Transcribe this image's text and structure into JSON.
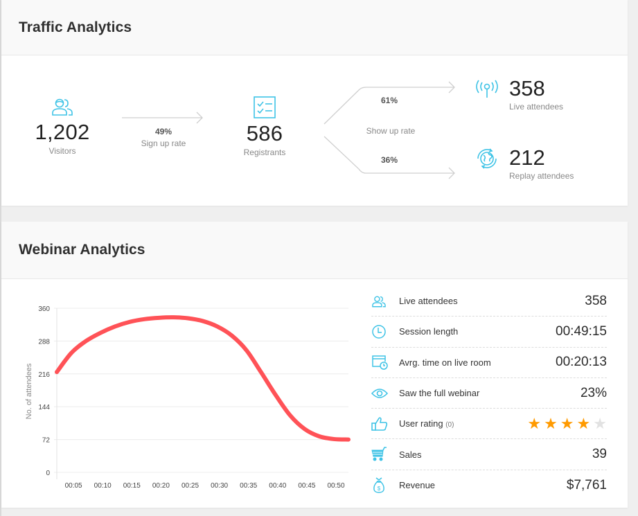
{
  "traffic": {
    "title": "Traffic Analytics",
    "visitors": {
      "value": "1,202",
      "label": "Visitors",
      "icon": "users-icon"
    },
    "signup": {
      "pct": "49%",
      "label": "Sign up rate"
    },
    "registrants": {
      "value": "586",
      "label": "Registrants",
      "icon": "checklist-icon"
    },
    "showup": {
      "label": "Show up rate",
      "live_pct": "61%",
      "replay_pct": "36%"
    },
    "live": {
      "value": "358",
      "label": "Live attendees",
      "icon": "broadcast-icon"
    },
    "replay": {
      "value": "212",
      "label": "Replay attendees",
      "icon": "globe-replay-icon"
    }
  },
  "webinar": {
    "title": "Webinar Analytics",
    "stats": [
      {
        "icon": "users-icon",
        "label": "Live attendees",
        "value": "358"
      },
      {
        "icon": "clock-icon",
        "label": "Session length",
        "value": "00:49:15"
      },
      {
        "icon": "window-clock-icon",
        "label": "Avrg. time on live room",
        "value": "00:20:13"
      },
      {
        "icon": "eye-icon",
        "label": "Saw the full webinar",
        "value": "23%"
      },
      {
        "icon": "thumbs-up-icon",
        "label": "User rating",
        "count": "(0)",
        "rating": 4,
        "rating_max": 5
      },
      {
        "icon": "cart-icon",
        "label": "Sales",
        "value": "39"
      },
      {
        "icon": "money-bag-icon",
        "label": "Revenue",
        "value": "$7,761"
      }
    ],
    "colors": {
      "accent": "#3ec3e6",
      "curve": "#ff5257",
      "star_on": "#ff9a00",
      "star_off": "#e2e2e2"
    }
  },
  "chart_data": {
    "type": "line",
    "title": "",
    "xlabel": "",
    "ylabel": "No. of attendees",
    "x_ticks": [
      "00:05",
      "00:10",
      "00:15",
      "00:20",
      "00:25",
      "00:30",
      "00:35",
      "00:40",
      "00:45",
      "00:50"
    ],
    "y_ticks": [
      0,
      72,
      144,
      216,
      288,
      360
    ],
    "ylim": [
      0,
      360
    ],
    "xlim_minutes": [
      0,
      50
    ],
    "grid": true,
    "series": [
      {
        "name": "Live attendees",
        "x_minutes": [
          0,
          2.5,
          5,
          7.5,
          10,
          12.5,
          15,
          17.5,
          20,
          22.5,
          25,
          27.5,
          30,
          32.5,
          35,
          37.5,
          40,
          42.5,
          45,
          47.5,
          50
        ],
        "values": [
          220,
          262,
          288,
          306,
          320,
          330,
          336,
          339,
          340,
          338,
          332,
          320,
          300,
          268,
          220,
          170,
          125,
          95,
          79,
          73,
          72
        ]
      }
    ]
  }
}
